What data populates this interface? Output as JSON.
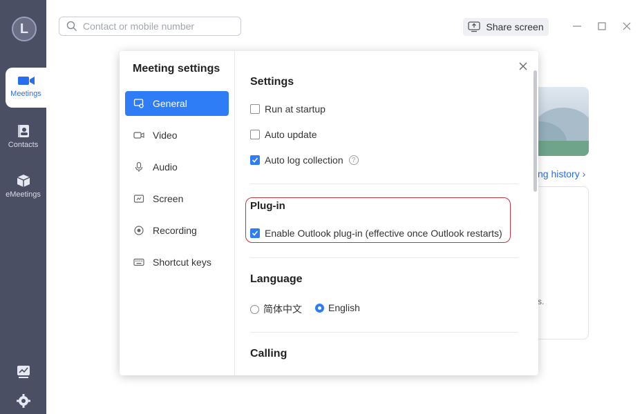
{
  "app": {
    "logo_letter": "L"
  },
  "sidebar": {
    "items": [
      {
        "label": "Meetings",
        "icon": "video-camera-icon",
        "active": true
      },
      {
        "label": "Contacts",
        "icon": "contacts-icon",
        "active": false
      },
      {
        "label": "eMeetings",
        "icon": "cube-icon",
        "active": false
      }
    ],
    "bottom_icons": [
      "presentation-chart-icon",
      "gear-icon"
    ]
  },
  "topbar": {
    "search_placeholder": "Contact or mobile number",
    "share_label": "Share screen"
  },
  "background": {
    "history_link": "ng history ›",
    "card_fragment": "s."
  },
  "dialog": {
    "title": "Meeting settings",
    "menu": [
      {
        "label": "General",
        "icon": "general-icon",
        "active": true
      },
      {
        "label": "Video",
        "icon": "video-icon",
        "active": false
      },
      {
        "label": "Audio",
        "icon": "microphone-icon",
        "active": false
      },
      {
        "label": "Screen",
        "icon": "screen-icon",
        "active": false
      },
      {
        "label": "Recording",
        "icon": "record-icon",
        "active": false
      },
      {
        "label": "Shortcut keys",
        "icon": "keyboard-icon",
        "active": false
      }
    ],
    "settings": {
      "title": "Settings",
      "options": [
        {
          "label": "Run at startup",
          "checked": false
        },
        {
          "label": "Auto update",
          "checked": false
        },
        {
          "label": "Auto log collection",
          "checked": true
        }
      ]
    },
    "plugin": {
      "title": "Plug-in",
      "option": {
        "label": "Enable Outlook plug-in (effective once Outlook restarts)",
        "checked": true
      }
    },
    "language": {
      "title": "Language",
      "options": [
        {
          "label": "简体中文",
          "selected": false
        },
        {
          "label": "English",
          "selected": true
        }
      ]
    },
    "calling": {
      "title": "Calling"
    }
  },
  "colors": {
    "accent": "#2e7cf6",
    "rail": "#4a4f63",
    "highlight_border": "#c0363d"
  }
}
